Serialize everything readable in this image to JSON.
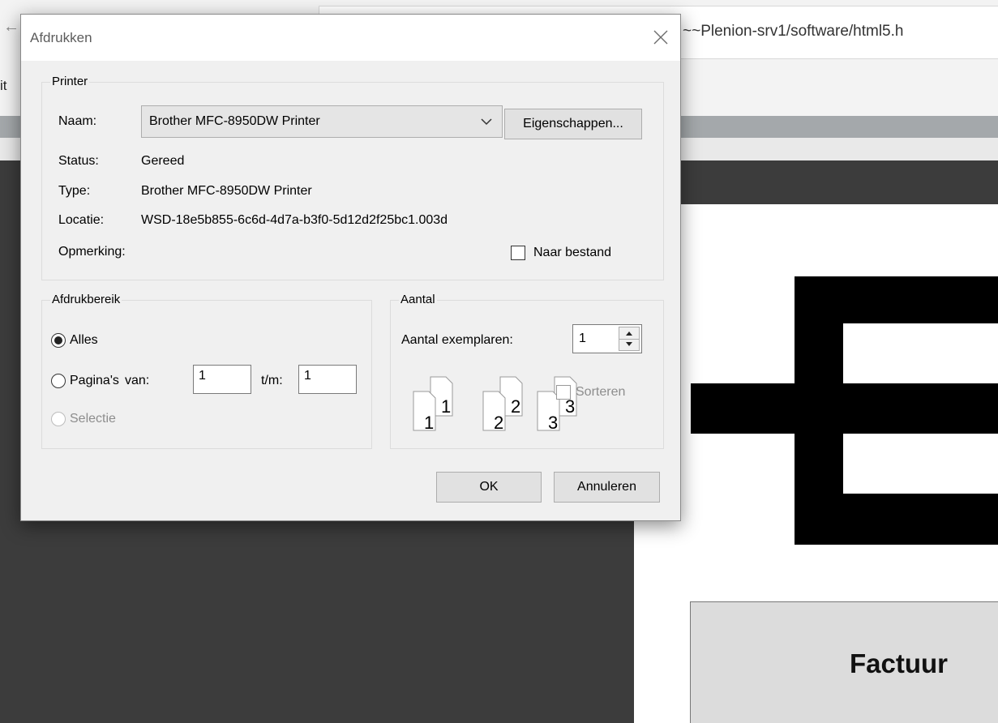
{
  "background": {
    "address_text": "~~Plenion-srv1/software/html5.h",
    "toolbar_fragment": "it",
    "document_heading": "Factuur"
  },
  "dialog": {
    "title": "Afdrukken",
    "printer": {
      "group_label": "Printer",
      "name_label": "Naam:",
      "name_value": "Brother MFC-8950DW Printer",
      "properties_button": "Eigenschappen...",
      "status_label": "Status:",
      "status_value": "Gereed",
      "type_label": "Type:",
      "type_value": "Brother MFC-8950DW Printer",
      "location_label": "Locatie:",
      "location_value": "WSD-18e5b855-6c6d-4d7a-b3f0-5d12d2f25bc1.003d",
      "comment_label": "Opmerking:",
      "to_file_label": "Naar bestand",
      "to_file_checked": false
    },
    "range": {
      "group_label": "Afdrukbereik",
      "all_label": "Alles",
      "pages_label": "Pagina's",
      "from_label": "van:",
      "from_value": "1",
      "to_label": "t/m:",
      "to_value": "1",
      "selection_label": "Selectie",
      "selected": "all"
    },
    "copies": {
      "group_label": "Aantal",
      "count_label": "Aantal exemplaren:",
      "count_value": "1",
      "collate_label": "Sorteren",
      "collate_checked": false,
      "icon_labels": [
        "1",
        "1",
        "2",
        "2",
        "3",
        "3"
      ]
    },
    "buttons": {
      "ok": "OK",
      "cancel": "Annuleren"
    }
  }
}
